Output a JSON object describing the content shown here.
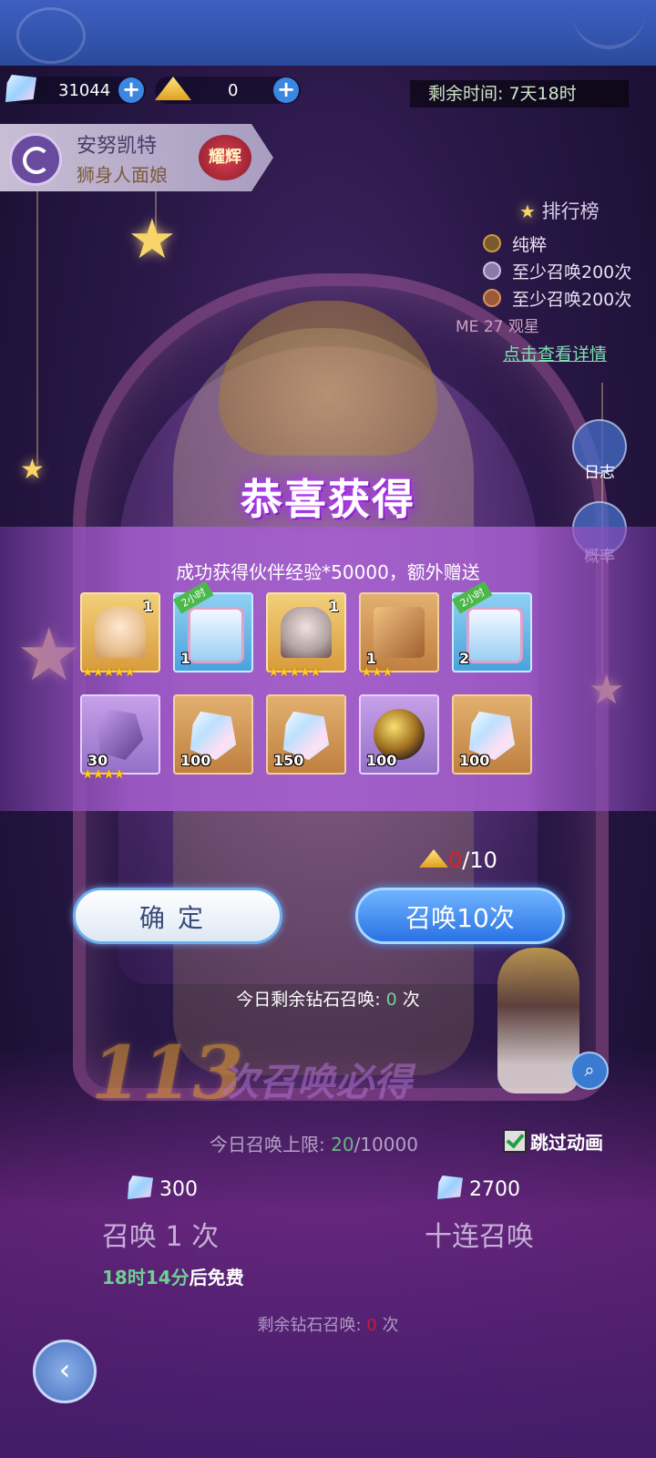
{
  "currency": {
    "diamonds": "31044",
    "gold": "0",
    "plus": "+"
  },
  "timer": "剩余时间: 7天18时",
  "character": {
    "name": "安努凯特",
    "title": "狮身人面娘",
    "badge": "耀辉"
  },
  "ranking": {
    "title": "排行榜",
    "items": [
      "纯粹",
      "至少召唤200次",
      "至少召唤200次"
    ],
    "me": "ME 27 观星",
    "link": "点击查看详情"
  },
  "side": {
    "log": "日志",
    "prob": "概率"
  },
  "dialog": {
    "title": "恭喜获得",
    "subtitle": "成功获得伙伴经验*50000，额外赠送",
    "row1": [
      {
        "count": "1",
        "stars": "★★★★★",
        "tag": ""
      },
      {
        "count": "1",
        "stars": "",
        "tag": "2小时"
      },
      {
        "count": "1",
        "stars": "★★★★★",
        "tag": ""
      },
      {
        "count": "1",
        "stars": "★★★",
        "tag": ""
      },
      {
        "count": "2",
        "stars": "",
        "tag": "2小时"
      }
    ],
    "row2": [
      {
        "count": "30",
        "stars": "★★★★"
      },
      {
        "count": "100",
        "stars": ""
      },
      {
        "count": "150",
        "stars": ""
      },
      {
        "count": "100",
        "stars": ""
      },
      {
        "count": "100",
        "stars": ""
      }
    ]
  },
  "cost": {
    "have": "0",
    "need": "/10"
  },
  "buttons": {
    "confirm": "确定",
    "summon10": "召唤10次"
  },
  "today": {
    "prefix": "今日剩余钻石召唤: ",
    "count": "0",
    "suffix": " 次"
  },
  "pity": {
    "number": "113",
    "text": "次召唤必得"
  },
  "limit": {
    "prefix": "今日召唤上限: ",
    "used": "20",
    "total": "/10000"
  },
  "skip": "跳过动画",
  "summon_costs": {
    "single": "300",
    "ten": "2700"
  },
  "summon_labels": {
    "single": "召唤 1 次",
    "ten": "十连召唤"
  },
  "free": {
    "time": "18时14分",
    "suffix": "后免费"
  },
  "remain_bottom": {
    "prefix": "剩余钻石召唤: ",
    "count": "0",
    "suffix": " 次"
  }
}
